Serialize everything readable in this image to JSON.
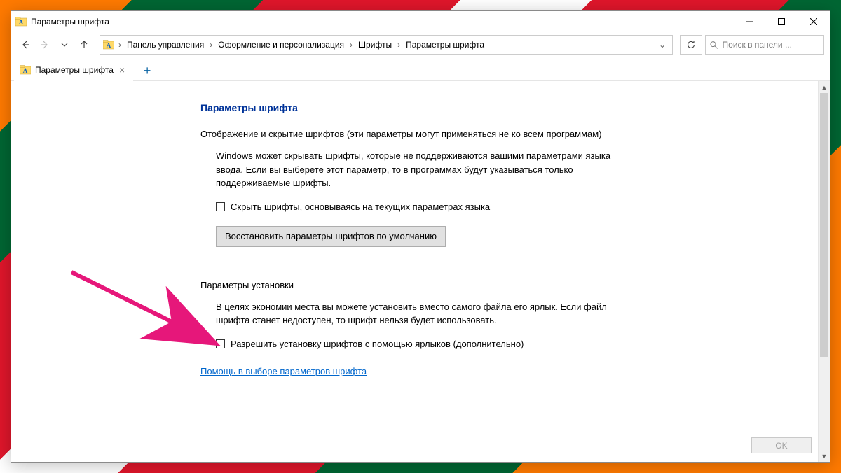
{
  "titlebar": {
    "title": "Параметры шрифта"
  },
  "breadcrumbs": [
    "Панель управления",
    "Оформление и персонализация",
    "Шрифты",
    "Параметры шрифта"
  ],
  "search": {
    "placeholder": "Поиск в панели ..."
  },
  "tab": {
    "label": "Параметры шрифта"
  },
  "page": {
    "heading": "Параметры шрифта",
    "section1_head": "Отображение и скрытие шрифтов (эти параметры могут применяться не ко всем программам)",
    "section1_body": "Windows может скрывать шрифты, которые не поддерживаются вашими параметрами языка ввода. Если вы выберете этот параметр, то в программах будут указываться только поддерживаемые шрифты.",
    "checkbox1": "Скрыть шрифты, основываясь на текущих параметрах языка",
    "restore_btn": "Восстановить параметры шрифтов по умолчанию",
    "section2_head": "Параметры установки",
    "section2_body": "В целях экономии места вы можете установить вместо самого файла его ярлык. Если файл шрифта станет недоступен, то шрифт нельзя будет использовать.",
    "checkbox2": "Разрешить установку шрифтов с помощью ярлыков (дополнительно)",
    "help_link": "Помощь в выборе параметров шрифта",
    "ok": "OK"
  }
}
